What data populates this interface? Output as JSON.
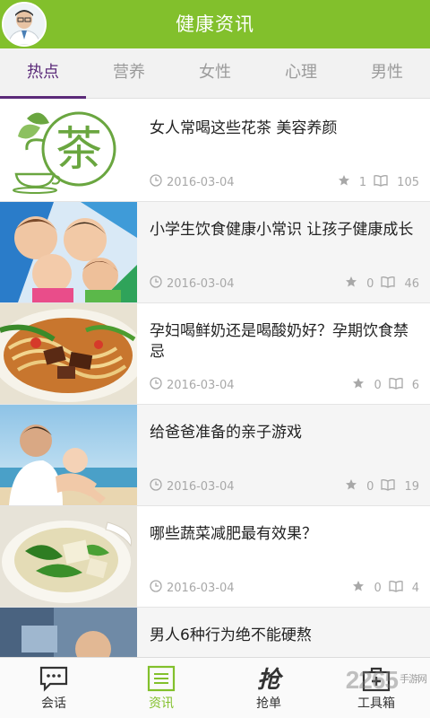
{
  "header": {
    "title": "健康资讯"
  },
  "tabs": [
    {
      "label": "热点",
      "active": true
    },
    {
      "label": "营养",
      "active": false
    },
    {
      "label": "女性",
      "active": false
    },
    {
      "label": "心理",
      "active": false
    },
    {
      "label": "男性",
      "active": false
    }
  ],
  "articles": [
    {
      "title": "女人常喝这些花茶 美容养颜",
      "date": "2016-03-04",
      "stars": "1",
      "reads": "105",
      "thumb_icon": "tea-logo-image",
      "thumb_text": "茶"
    },
    {
      "title": "小学生饮食健康小常识 让孩子健康成长",
      "date": "2016-03-04",
      "stars": "0",
      "reads": "46",
      "thumb_icon": "children-photo"
    },
    {
      "title": "孕妇喝鲜奶还是喝酸奶好？孕期饮食禁忌",
      "date": "2016-03-04",
      "stars": "0",
      "reads": "6",
      "thumb_icon": "noodles-photo"
    },
    {
      "title": "给爸爸准备的亲子游戏",
      "date": "2016-03-04",
      "stars": "0",
      "reads": "19",
      "thumb_icon": "father-baby-beach-photo"
    },
    {
      "title": "哪些蔬菜减肥最有效果？",
      "date": "2016-03-04",
      "stars": "0",
      "reads": "4",
      "thumb_icon": "vegetable-soup-photo"
    },
    {
      "title": "男人6种行为绝不能硬熬",
      "thumb_icon": "man-photo"
    }
  ],
  "bottom_nav": [
    {
      "label": "会话",
      "icon": "chat-icon",
      "active": false
    },
    {
      "label": "资讯",
      "icon": "news-icon",
      "active": true
    },
    {
      "label": "抢单",
      "icon": "grab-order-icon",
      "active": false,
      "icon_text": "抢"
    },
    {
      "label": "工具箱",
      "icon": "toolbox-icon",
      "active": false
    }
  ],
  "watermark": {
    "text": "2265",
    "sub": "手游网"
  },
  "colors": {
    "brand_green": "#82c02c",
    "tab_active": "#5b2a79",
    "meta_gray": "#a8a8a8"
  }
}
